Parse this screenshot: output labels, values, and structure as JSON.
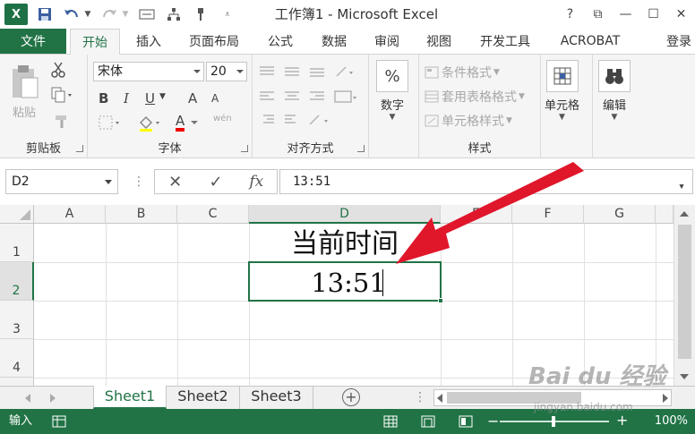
{
  "window": {
    "title": "工作簿1 - Microsoft Excel",
    "app_icon": "X",
    "controls": [
      "?",
      "⧉",
      "—",
      "☐",
      "✕"
    ]
  },
  "tabs": {
    "file": "文件",
    "items": [
      "开始",
      "插入",
      "页面布局",
      "公式",
      "数据",
      "审阅",
      "视图",
      "开发工具",
      "ACROBAT"
    ],
    "active": "开始",
    "login": "登录"
  },
  "ribbon": {
    "clipboard": {
      "label": "剪贴板",
      "paste": "粘贴"
    },
    "font": {
      "label": "字体",
      "font_name": "宋体",
      "font_size": "20",
      "bold": "B",
      "italic": "I",
      "underline": "U",
      "grow": "A",
      "shrink": "A",
      "font_color": "A",
      "phonetic": "wén"
    },
    "alignment": {
      "label": "对齐方式"
    },
    "number": {
      "label": "数字",
      "symbol": "%"
    },
    "styles": {
      "label": "样式",
      "conditional": "条件格式",
      "table": "套用表格格式",
      "cell_styles": "单元格样式"
    },
    "cells": {
      "label": "单元格"
    },
    "editing": {
      "label": "编辑"
    }
  },
  "formula_bar": {
    "name_box": "D2",
    "cancel": "✕",
    "enter": "✓",
    "fx": "fx",
    "value": "13:51"
  },
  "grid": {
    "columns": [
      "A",
      "B",
      "C",
      "D",
      "E",
      "F",
      "G"
    ],
    "selected_column": "D",
    "rows": [
      "1",
      "2",
      "3",
      "4"
    ],
    "selected_row": "2",
    "cells": {
      "D1": "当前时间",
      "D2": "13:51"
    }
  },
  "sheets": {
    "tabs": [
      "Sheet1",
      "Sheet2",
      "Sheet3"
    ],
    "active": "Sheet1",
    "add": "+"
  },
  "status": {
    "mode": "输入",
    "zoom": "100%"
  },
  "watermark": {
    "text": "Bai du 经验",
    "url": "jingyan.baidu.com"
  },
  "colors": {
    "accent": "#217346",
    "annotation_arrow": "#e0162b"
  }
}
